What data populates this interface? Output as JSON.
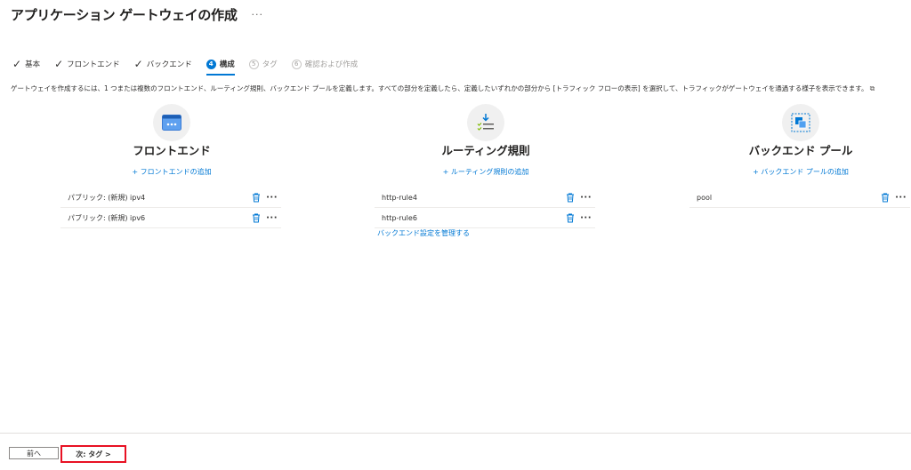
{
  "page": {
    "title": "アプリケーション ゲートウェイの作成",
    "more": "···"
  },
  "steps": [
    {
      "label": "基本",
      "state": "done"
    },
    {
      "label": "フロントエンド",
      "state": "done"
    },
    {
      "label": "バックエンド",
      "state": "done"
    },
    {
      "label": "構成",
      "state": "active",
      "number": "4"
    },
    {
      "label": "タグ",
      "state": "disabled",
      "number": "5"
    },
    {
      "label": "確認および作成",
      "state": "disabled",
      "number": "6"
    }
  ],
  "description": "ゲートウェイを作成するには、1 つまたは複数のフロントエンド、ルーティング規則、バックエンド プールを定義します。すべての部分を定義したら、定義したいずれかの部分から [トラフィック フローの表示] を選択して、トラフィックがゲートウェイを通過する様子を表示できます。",
  "columns": {
    "frontend": {
      "title": "フロントエンド",
      "add": "+ フロントエンドの追加",
      "icon": "frontend-icon",
      "rows": [
        "パブリック: (新規) ipv4",
        "パブリック: (新規) ipv6"
      ]
    },
    "routing": {
      "title": "ルーティング規則",
      "add": "+ ルーティング規則の追加",
      "icon": "routing-rules-icon",
      "rows": [
        "http-rule4",
        "http-rule6"
      ],
      "manage": "バックエンド設定を管理する"
    },
    "backend": {
      "title": "バックエンド プール",
      "add": "+ バックエンド プールの追加",
      "icon": "backend-pool-icon",
      "rows": [
        "pool"
      ]
    }
  },
  "footer": {
    "prev": "前へ",
    "next": "次: タグ >"
  },
  "colors": {
    "accent": "#0078d4",
    "highlight": "#e81123"
  }
}
